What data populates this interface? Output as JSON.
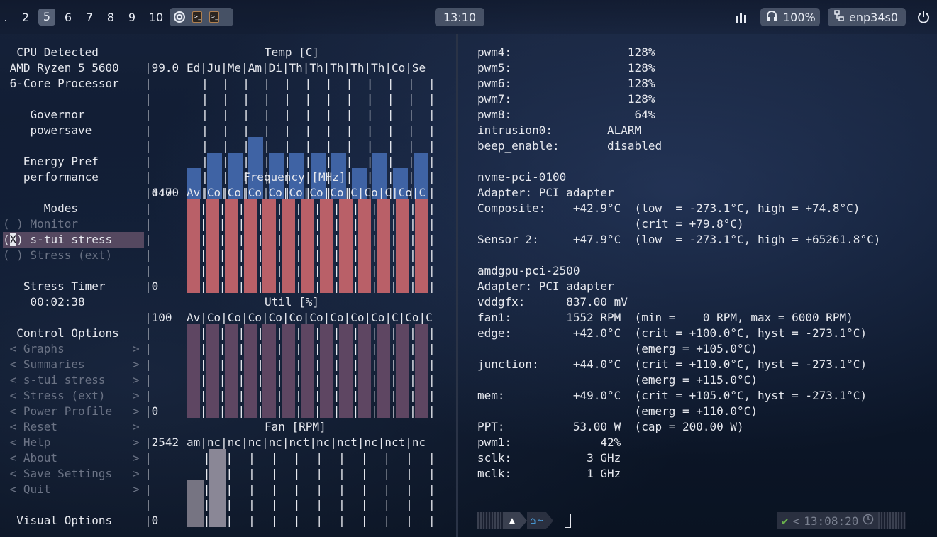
{
  "topbar": {
    "workspaces": [
      ".",
      "2",
      "5",
      "6",
      "7",
      "8",
      "9",
      "10"
    ],
    "active_workspace": "5",
    "clock": "13:10",
    "volume": "100%",
    "network": "enp34s0"
  },
  "stui": {
    "left_lines": [
      {
        "t": "  CPU Detected  "
      },
      {
        "t": " AMD Ryzen 5 5600"
      },
      {
        "t": " 6-Core Processor"
      },
      {
        "t": ""
      },
      {
        "t": "    Governor"
      },
      {
        "t": "    powersave"
      },
      {
        "t": ""
      },
      {
        "t": "   Energy Pref"
      },
      {
        "t": "   performance"
      },
      {
        "t": ""
      },
      {
        "t": "      Modes"
      },
      {
        "t": "( ) Monitor",
        "dim": true
      },
      {
        "t": "(X) s-tui stress",
        "sel": true
      },
      {
        "t": "( ) Stress (ext)",
        "dim": true
      },
      {
        "t": ""
      },
      {
        "t": "   Stress Timer"
      },
      {
        "t": "    00:02:38"
      },
      {
        "t": ""
      },
      {
        "t": "  Control Options"
      },
      {
        "t": " < Graphs          >",
        "dim": true
      },
      {
        "t": " < Summaries       >",
        "dim": true
      },
      {
        "t": " < s-tui stress    >",
        "dim": true
      },
      {
        "t": " < Stress (ext)    >",
        "dim": true
      },
      {
        "t": " < Power Profile   >",
        "dim": true
      },
      {
        "t": " < Reset           >",
        "dim": true
      },
      {
        "t": " < Help            >",
        "dim": true
      },
      {
        "t": " < About           >",
        "dim": true
      },
      {
        "t": " < Save Settings   >",
        "dim": true
      },
      {
        "t": " < Quit            >",
        "dim": true
      },
      {
        "t": ""
      },
      {
        "t": "  Visual Options"
      }
    ],
    "graphs": [
      {
        "title": "Temp [C]",
        "max": "99.0",
        "min": "0.0",
        "labels": "Ed|Ju|Me|Am|Di|Th|Th|Th|Th|Th|Co|Se",
        "color": "#3f63a4",
        "cols": [
          2,
          3,
          3,
          4,
          3,
          3,
          3,
          3,
          2,
          3,
          2,
          3
        ],
        "rows": 8
      },
      {
        "title": "Frequency [MHz]",
        "max": "4470",
        "min": "0",
        "labels": "Av|Co|Co|Co|Co|Co|Co|Co|C|Co|C|Co|C",
        "color": "#b96068",
        "cols": [
          6,
          6,
          6,
          6,
          6,
          6,
          6,
          6,
          6,
          6,
          6,
          6,
          6
        ],
        "rows": 6
      },
      {
        "title": "Util [%]",
        "max": "100",
        "min": "0",
        "labels": "Av|Co|Co|Co|Co|Co|Co|Co|Co|Co|C|Co|C",
        "color": "#5e4662",
        "cols": [
          6,
          6,
          6,
          6,
          6,
          6,
          6,
          6,
          6,
          6,
          6,
          6,
          6
        ],
        "rows": 6
      },
      {
        "title": "Fan [RPM]",
        "max": "2542",
        "min": "0",
        "labels": "am|nc|nc|nc|nc|nct|nc|nct|nc|nct|nc",
        "color": "#767482",
        "cols": [
          3,
          5,
          0,
          0,
          0,
          0,
          0,
          0,
          0,
          0,
          0
        ],
        "rows": 5
      }
    ]
  },
  "sensors": {
    "lines": [
      "pwm4:                 128%",
      "pwm5:                 128%",
      "pwm6:                 128%",
      "pwm7:                 128%",
      "pwm8:                  64%",
      "intrusion0:        ALARM",
      "beep_enable:       disabled",
      "",
      "nvme-pci-0100",
      "Adapter: PCI adapter",
      "Composite:    +42.9°C  (low  = -273.1°C, high = +74.8°C)",
      "                       (crit = +79.8°C)",
      "Sensor 2:     +47.9°C  (low  = -273.1°C, high = +65261.8°C)",
      "",
      "amdgpu-pci-2500",
      "Adapter: PCI adapter",
      "vddgfx:      837.00 mV",
      "fan1:        1552 RPM  (min =    0 RPM, max = 6000 RPM)",
      "edge:         +42.0°C  (crit = +100.0°C, hyst = -273.1°C)",
      "                       (emerg = +105.0°C)",
      "junction:     +44.0°C  (crit = +110.0°C, hyst = -273.1°C)",
      "                       (emerg = +115.0°C)",
      "mem:          +49.0°C  (crit = +105.0°C, hyst = -273.1°C)",
      "                       (emerg = +110.0°C)",
      "PPT:          53.00 W  (cap = 200.00 W)",
      "pwm1:             42%",
      "sclk:           3 GHz",
      "mclk:           1 GHz"
    ]
  },
  "prompt": {
    "home": "~",
    "time": "13:08:20",
    "check": "✔"
  }
}
